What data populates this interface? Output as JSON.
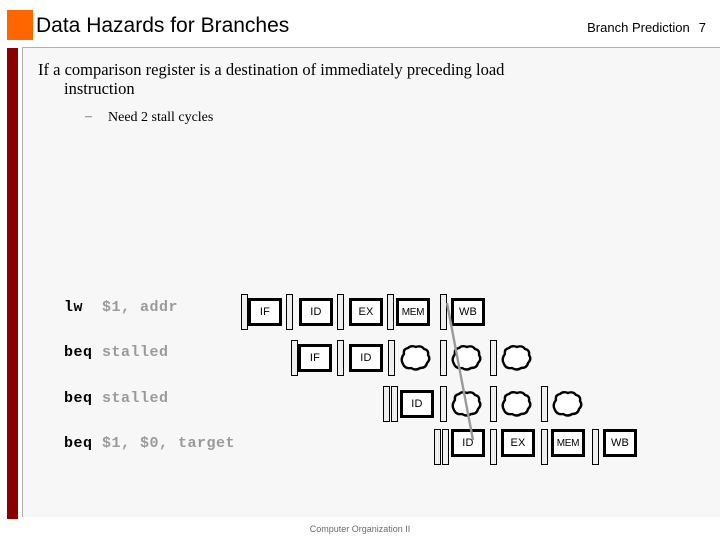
{
  "header": {
    "title": "Data Hazards for Branches",
    "subtitle": "Branch Prediction",
    "slide_number": "7",
    "accent_color": "#FF6600",
    "spine_color": "#8B0000"
  },
  "bullets": {
    "level1_line1": "If a comparison register is a destination of immediately preceding load",
    "level1_line2": "instruction",
    "level2_dash": "–",
    "level2_text": "Need 2 stall cycles"
  },
  "pipeline": {
    "stage_labels": {
      "if": "IF",
      "id": "ID",
      "ex": "EX",
      "mem": "MEM",
      "wb": "WB"
    },
    "rows": [
      {
        "op": "lw  ",
        "args": "$1, addr",
        "stages": [
          "IF",
          "ID",
          "EX",
          "MEM",
          "WB"
        ]
      },
      {
        "op": "beq ",
        "args": "stalled",
        "stages": [
          "IF",
          "ID",
          "bubble",
          "bubble",
          "bubble"
        ]
      },
      {
        "op": "beq ",
        "args": "stalled",
        "stages": [
          "ID",
          "bubble",
          "bubble",
          "bubble"
        ]
      },
      {
        "op": "beq ",
        "args": "$1, $0, target",
        "stages": [
          "ID",
          "EX",
          "MEM",
          "WB"
        ]
      }
    ],
    "forwarding_arrow": {
      "color": "#9a9a9a",
      "from": "MEM/WB of lw",
      "to": "ID of beq"
    }
  },
  "footer": {
    "text": "Computer Organization II"
  }
}
